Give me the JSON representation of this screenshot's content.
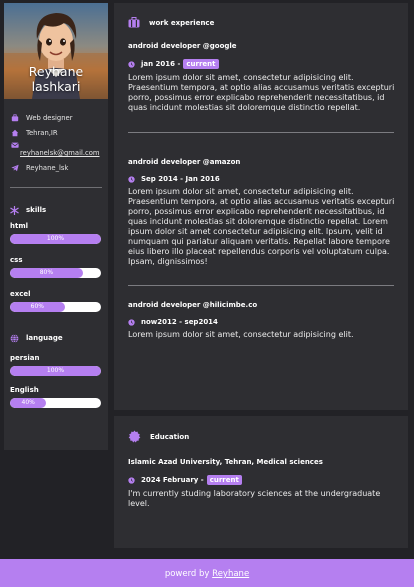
{
  "profile": {
    "name_line1": "Reyhane",
    "name_line2": "lashkari",
    "job": "Web designer",
    "location": "Tehran,IR",
    "email": "reyhanelsk@gmail.com",
    "telegram": "Reyhane_lsk"
  },
  "skills": {
    "title": "skills",
    "items": [
      {
        "name": "html",
        "percent_label": "100%",
        "level": 100
      },
      {
        "name": "css",
        "percent_label": "80%",
        "level": 80
      },
      {
        "name": "excel",
        "percent_label": "60%",
        "level": 60
      }
    ]
  },
  "language": {
    "title": "language",
    "items": [
      {
        "name": "persian",
        "percent_label": "100%",
        "level": 100
      },
      {
        "name": "English",
        "percent_label": "40%",
        "level": 40
      }
    ]
  },
  "work": {
    "title": "work experience",
    "jobs": [
      {
        "title": "android developer @google",
        "date": "jan 2016 -",
        "badge": "current",
        "desc": "Lorem ipsum dolor sit amet, consectetur adipisicing elit. Praesentium tempora, at optio alias accusamus veritatis excepturi porro, possimus error explicabo reprehenderit necessitatibus, id quas incidunt molestias sit doloremque distinctio repellat."
      },
      {
        "title": "android developer @amazon",
        "date": "Sep 2014 - Jan 2016",
        "badge": "",
        "desc": "Lorem ipsum dolor sit amet, consectetur adipisicing elit. Praesentium tempora, at optio alias accusamus veritatis excepturi porro, possimus error explicabo reprehenderit necessitatibus, id quas incidunt molestias sit doloremque distinctio repellat. Lorem ipsum dolor sit amet consectetur adipisicing elit. Ipsum, velit id numquam qui pariatur aliquam veritatis. Repellat labore tempore eius libero illo placeat repellendus corporis vel voluptatum culpa. Ipsam, dignissimos!"
      },
      {
        "title": "android developer @hilicimbe.co",
        "date": "now2012 - sep2014",
        "badge": "",
        "desc": "Lorem ipsum dolor sit amet, consectetur adipisicing elit."
      }
    ]
  },
  "education": {
    "title": "Education",
    "school": "Islamic Azad University, Tehran, Medical sciences",
    "date": "2024 February -",
    "badge": "current",
    "desc": "I'm currently studing laboratory sciences at the undergraduate level."
  },
  "footer": {
    "prefix": "powerd by",
    "link": "Reyhane"
  },
  "colors": {
    "accent": "#b57ff0",
    "background": "#222226",
    "card": "#2e2e32"
  }
}
